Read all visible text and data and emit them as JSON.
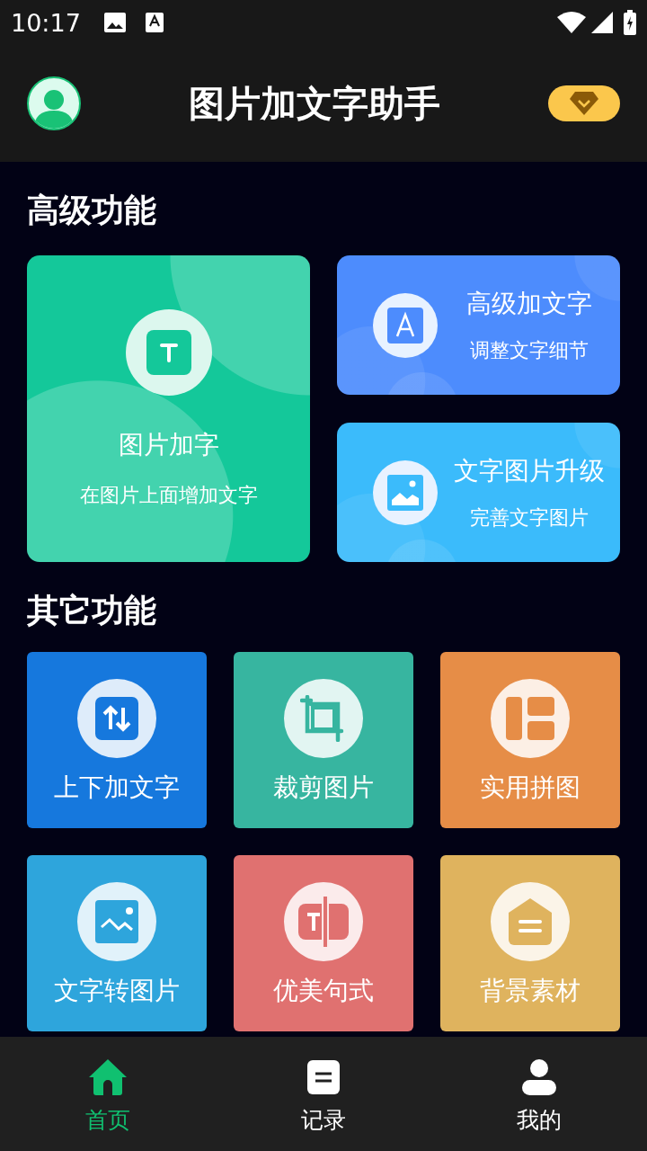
{
  "status_bar": {
    "time": "10:17"
  },
  "header": {
    "title": "图片加文字助手"
  },
  "premium": {
    "title": "高级功能",
    "cards": [
      {
        "kind": "text",
        "title": "图片加字",
        "subtitle": "在图片上面增加文字",
        "color": "#14c89a"
      },
      {
        "kind": "letter",
        "title": "高级加文字",
        "subtitle": "调整文字细节",
        "color": "#4d8cfd"
      },
      {
        "kind": "image",
        "title": "文字图片升级",
        "subtitle": "完善文字图片",
        "color": "#3bbbfb"
      }
    ]
  },
  "others": {
    "title": "其它功能",
    "tiles": [
      {
        "kind": "updown",
        "label": "上下加文字",
        "color": "#1678dd"
      },
      {
        "kind": "crop",
        "label": "裁剪图片",
        "color": "#37b5a0"
      },
      {
        "kind": "collage",
        "label": "实用拼图",
        "color": "#e68d47"
      },
      {
        "kind": "picture",
        "label": "文字转图片",
        "color": "#2ea5dc"
      },
      {
        "kind": "textbar",
        "label": "优美句式",
        "color": "#e07170"
      },
      {
        "kind": "tag",
        "label": "背景素材",
        "color": "#dfb35e"
      }
    ]
  },
  "bottom_nav": [
    {
      "kind": "home",
      "label": "首页",
      "selected": true
    },
    {
      "kind": "record",
      "label": "记录",
      "selected": false
    },
    {
      "kind": "person",
      "label": "我的",
      "selected": false
    }
  ]
}
